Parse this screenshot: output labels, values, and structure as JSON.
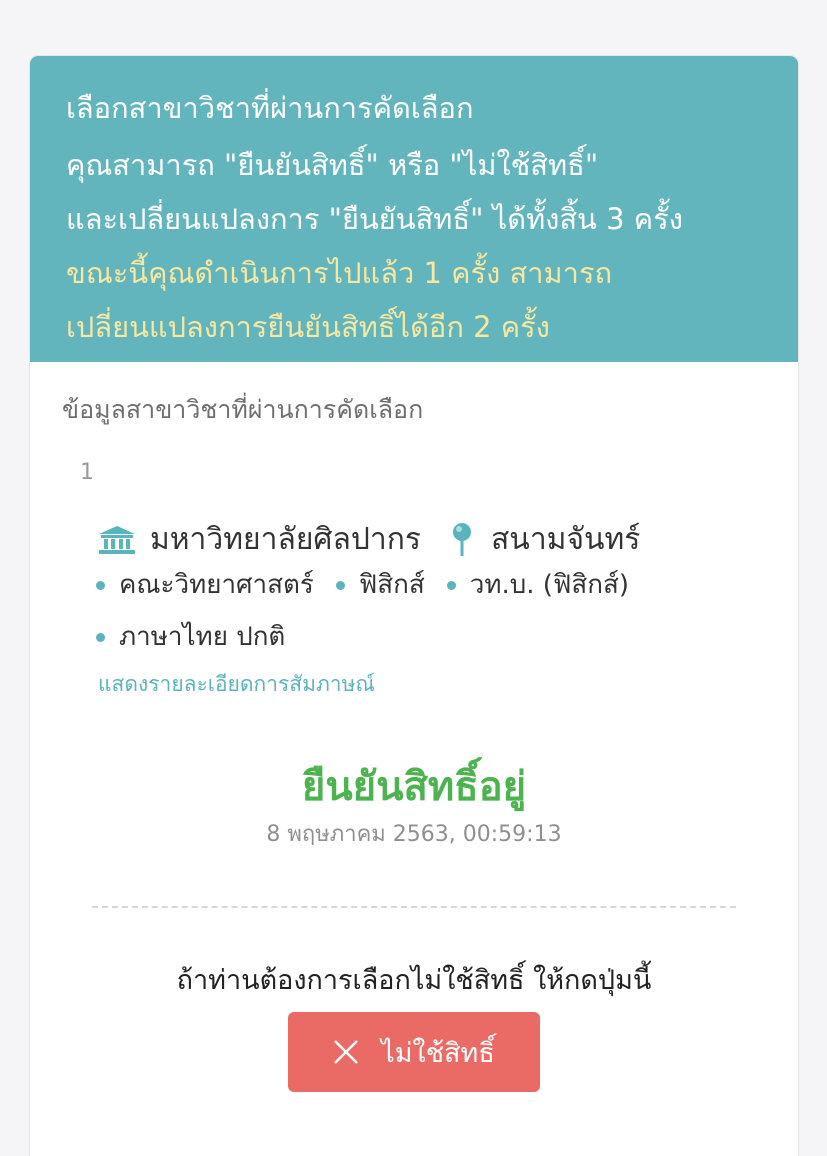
{
  "header": {
    "title": "เลือกสาขาวิชาที่ผ่านการคัดเลือก",
    "line1": "คุณสามารถ \"ยืนยันสิทธิ์\" หรือ \"ไม่ใช้สิทธิ์\"",
    "line2": "และเปลี่ยนแปลงการ \"ยืนยันสิทธิ์\" ได้ทั้งสิ้น 3 ครั้ง",
    "highlight1": "ขณะนี้คุณดำเนินการไปแล้ว 1 ครั้ง สามารถ",
    "highlight2": "เปลี่ยนแปลงการยืนยันสิทธิ์ได้อีก 2 ครั้ง"
  },
  "section_title": "ข้อมูลสาขาวิชาที่ผ่านการคัดเลือก",
  "item": {
    "number": "1",
    "university": "มหาวิทยาลัยศิลปากร",
    "campus": "สนามจันทร์",
    "faculty": "คณะวิทยาศาสตร์",
    "major": "ฟิสิกส์",
    "degree": "วท.บ. (ฟิสิกส์)",
    "program": "ภาษาไทย ปกติ",
    "interview_link": "แสดงรายละเอียดการสัมภาษณ์"
  },
  "status": {
    "label": "ยืนยันสิทธิ์อยู่",
    "timestamp": "8 พฤษภาคม 2563, 00:59:13"
  },
  "decline": {
    "prompt": "ถ้าท่านต้องการเลือกไม่ใช้สิทธิ์ ให้กดปุ่มนี้",
    "button_label": "ไม่ใช้สิทธิ์"
  },
  "colors": {
    "header_bg": "#62b5bc",
    "highlight": "#f6e7a1",
    "accent": "#5ab4bb",
    "status_green": "#4cb34f",
    "decline_red": "#ea6b66"
  },
  "icons": {
    "university": "university-building-icon",
    "campus": "map-pin-icon",
    "decline": "close-icon"
  }
}
